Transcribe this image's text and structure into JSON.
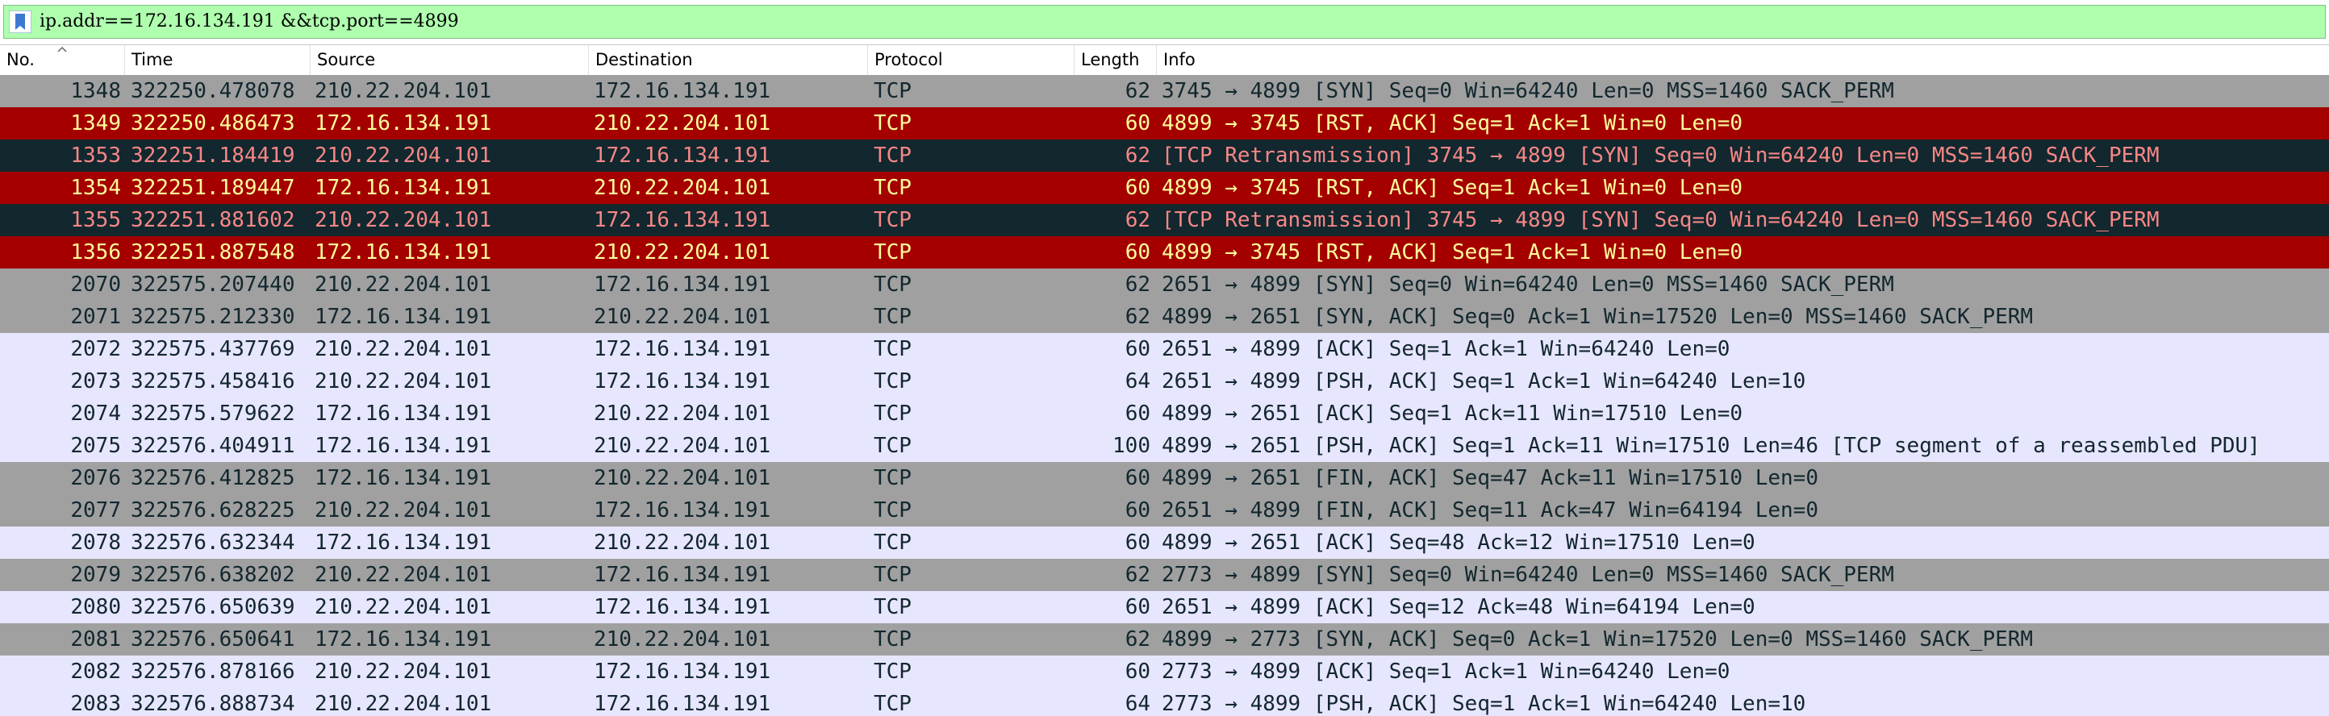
{
  "filter": {
    "text": "ip.addr==172.16.134.191 &&tcp.port==4899",
    "bookmark_icon": "bookmark-icon"
  },
  "columns": [
    "No.",
    "Time",
    "Source",
    "Destination",
    "Protocol",
    "Length",
    "Info"
  ],
  "sort_icon": "sort-ascending-icon",
  "styles": {
    "gray": {
      "bg": "#a0a0a0",
      "fg": "#12272e"
    },
    "red": {
      "bg": "#a40000",
      "fg": "#fffc9c"
    },
    "dark": {
      "bg": "#12272e",
      "fg": "#f78787"
    },
    "light": {
      "bg": "#e7e6ff",
      "fg": "#12272e"
    }
  },
  "packets": [
    {
      "no": "1348",
      "time": "322250.478078",
      "src": "210.22.204.101",
      "dst": "172.16.134.191",
      "proto": "TCP",
      "len": "62",
      "info": "3745 → 4899 [SYN] Seq=0 Win=64240 Len=0 MSS=1460 SACK_PERM",
      "style": "gray"
    },
    {
      "no": "1349",
      "time": "322250.486473",
      "src": "172.16.134.191",
      "dst": "210.22.204.101",
      "proto": "TCP",
      "len": "60",
      "info": "4899 → 3745 [RST, ACK] Seq=1 Ack=1 Win=0 Len=0",
      "style": "red"
    },
    {
      "no": "1353",
      "time": "322251.184419",
      "src": "210.22.204.101",
      "dst": "172.16.134.191",
      "proto": "TCP",
      "len": "62",
      "info": "[TCP Retransmission] 3745 → 4899 [SYN] Seq=0 Win=64240 Len=0 MSS=1460 SACK_PERM",
      "style": "dark"
    },
    {
      "no": "1354",
      "time": "322251.189447",
      "src": "172.16.134.191",
      "dst": "210.22.204.101",
      "proto": "TCP",
      "len": "60",
      "info": "4899 → 3745 [RST, ACK] Seq=1 Ack=1 Win=0 Len=0",
      "style": "red"
    },
    {
      "no": "1355",
      "time": "322251.881602",
      "src": "210.22.204.101",
      "dst": "172.16.134.191",
      "proto": "TCP",
      "len": "62",
      "info": "[TCP Retransmission] 3745 → 4899 [SYN] Seq=0 Win=64240 Len=0 MSS=1460 SACK_PERM",
      "style": "dark"
    },
    {
      "no": "1356",
      "time": "322251.887548",
      "src": "172.16.134.191",
      "dst": "210.22.204.101",
      "proto": "TCP",
      "len": "60",
      "info": "4899 → 3745 [RST, ACK] Seq=1 Ack=1 Win=0 Len=0",
      "style": "red"
    },
    {
      "no": "2070",
      "time": "322575.207440",
      "src": "210.22.204.101",
      "dst": "172.16.134.191",
      "proto": "TCP",
      "len": "62",
      "info": "2651 → 4899 [SYN] Seq=0 Win=64240 Len=0 MSS=1460 SACK_PERM",
      "style": "gray"
    },
    {
      "no": "2071",
      "time": "322575.212330",
      "src": "172.16.134.191",
      "dst": "210.22.204.101",
      "proto": "TCP",
      "len": "62",
      "info": "4899 → 2651 [SYN, ACK] Seq=0 Ack=1 Win=17520 Len=0 MSS=1460 SACK_PERM",
      "style": "gray"
    },
    {
      "no": "2072",
      "time": "322575.437769",
      "src": "210.22.204.101",
      "dst": "172.16.134.191",
      "proto": "TCP",
      "len": "60",
      "info": "2651 → 4899 [ACK] Seq=1 Ack=1 Win=64240 Len=0",
      "style": "light"
    },
    {
      "no": "2073",
      "time": "322575.458416",
      "src": "210.22.204.101",
      "dst": "172.16.134.191",
      "proto": "TCP",
      "len": "64",
      "info": "2651 → 4899 [PSH, ACK] Seq=1 Ack=1 Win=64240 Len=10",
      "style": "light"
    },
    {
      "no": "2074",
      "time": "322575.579622",
      "src": "172.16.134.191",
      "dst": "210.22.204.101",
      "proto": "TCP",
      "len": "60",
      "info": "4899 → 2651 [ACK] Seq=1 Ack=11 Win=17510 Len=0",
      "style": "light"
    },
    {
      "no": "2075",
      "time": "322576.404911",
      "src": "172.16.134.191",
      "dst": "210.22.204.101",
      "proto": "TCP",
      "len": "100",
      "info": "4899 → 2651 [PSH, ACK] Seq=1 Ack=11 Win=17510 Len=46 [TCP segment of a reassembled PDU]",
      "style": "light"
    },
    {
      "no": "2076",
      "time": "322576.412825",
      "src": "172.16.134.191",
      "dst": "210.22.204.101",
      "proto": "TCP",
      "len": "60",
      "info": "4899 → 2651 [FIN, ACK] Seq=47 Ack=11 Win=17510 Len=0",
      "style": "gray"
    },
    {
      "no": "2077",
      "time": "322576.628225",
      "src": "210.22.204.101",
      "dst": "172.16.134.191",
      "proto": "TCP",
      "len": "60",
      "info": "2651 → 4899 [FIN, ACK] Seq=11 Ack=47 Win=64194 Len=0",
      "style": "gray"
    },
    {
      "no": "2078",
      "time": "322576.632344",
      "src": "172.16.134.191",
      "dst": "210.22.204.101",
      "proto": "TCP",
      "len": "60",
      "info": "4899 → 2651 [ACK] Seq=48 Ack=12 Win=17510 Len=0",
      "style": "light"
    },
    {
      "no": "2079",
      "time": "322576.638202",
      "src": "210.22.204.101",
      "dst": "172.16.134.191",
      "proto": "TCP",
      "len": "62",
      "info": "2773 → 4899 [SYN] Seq=0 Win=64240 Len=0 MSS=1460 SACK_PERM",
      "style": "gray"
    },
    {
      "no": "2080",
      "time": "322576.650639",
      "src": "210.22.204.101",
      "dst": "172.16.134.191",
      "proto": "TCP",
      "len": "60",
      "info": "2651 → 4899 [ACK] Seq=12 Ack=48 Win=64194 Len=0",
      "style": "light"
    },
    {
      "no": "2081",
      "time": "322576.650641",
      "src": "172.16.134.191",
      "dst": "210.22.204.101",
      "proto": "TCP",
      "len": "62",
      "info": "4899 → 2773 [SYN, ACK] Seq=0 Ack=1 Win=17520 Len=0 MSS=1460 SACK_PERM",
      "style": "gray"
    },
    {
      "no": "2082",
      "time": "322576.878166",
      "src": "210.22.204.101",
      "dst": "172.16.134.191",
      "proto": "TCP",
      "len": "60",
      "info": "2773 → 4899 [ACK] Seq=1 Ack=1 Win=64240 Len=0",
      "style": "light"
    },
    {
      "no": "2083",
      "time": "322576.888734",
      "src": "210.22.204.101",
      "dst": "172.16.134.191",
      "proto": "TCP",
      "len": "64",
      "info": "2773 → 4899 [PSH, ACK] Seq=1 Ack=1 Win=64240 Len=10",
      "style": "light"
    }
  ]
}
